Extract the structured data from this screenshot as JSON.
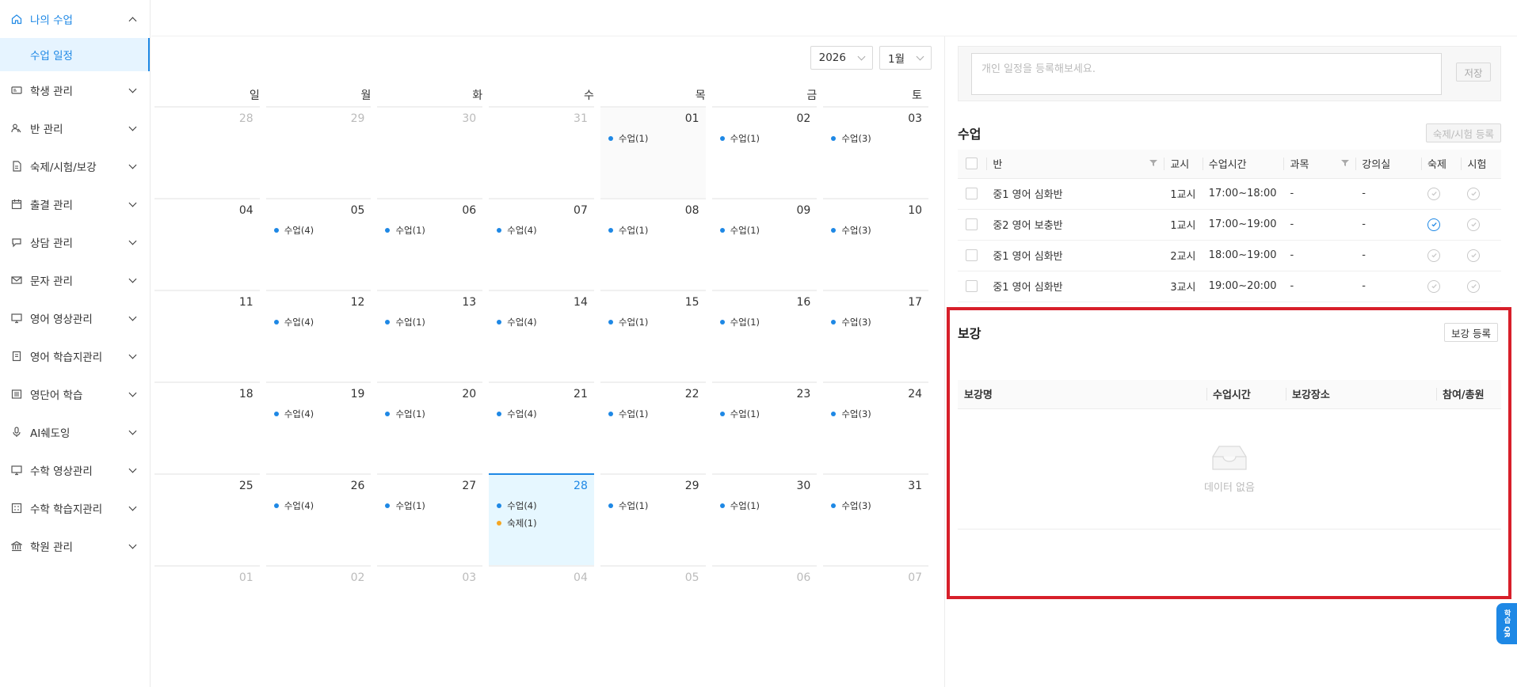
{
  "sidebar": {
    "items": [
      {
        "label": "나의 수업",
        "icon": "home-icon",
        "open": true,
        "sub": [
          {
            "label": "수업 일정"
          }
        ]
      },
      {
        "label": "학생 관리",
        "icon": "id-card-icon"
      },
      {
        "label": "반 관리",
        "icon": "users-icon"
      },
      {
        "label": "숙제/시험/보강",
        "icon": "file-icon"
      },
      {
        "label": "출결 관리",
        "icon": "calendar-icon"
      },
      {
        "label": "상담 관리",
        "icon": "chat-icon"
      },
      {
        "label": "문자 관리",
        "icon": "mail-icon"
      },
      {
        "label": "영어 영상관리",
        "icon": "monitor-icon"
      },
      {
        "label": "영어 학습지관리",
        "icon": "book-icon"
      },
      {
        "label": "영단어 학습",
        "icon": "word-icon"
      },
      {
        "label": "AI쉐도잉",
        "icon": "mic-icon"
      },
      {
        "label": "수학 영상관리",
        "icon": "monitor-icon"
      },
      {
        "label": "수학 학습지관리",
        "icon": "grid-icon"
      },
      {
        "label": "학원 관리",
        "icon": "bank-icon"
      }
    ]
  },
  "calendar": {
    "year": "2026",
    "month": "1월",
    "weekdays": [
      "일",
      "월",
      "화",
      "수",
      "목",
      "금",
      "토"
    ],
    "weeks": [
      [
        {
          "d": "28",
          "o": true
        },
        {
          "d": "29",
          "o": true
        },
        {
          "d": "30",
          "o": true
        },
        {
          "d": "31",
          "o": true
        },
        {
          "d": "01",
          "ev": [
            "수업(1)"
          ],
          "shade": true
        },
        {
          "d": "02",
          "ev": [
            "수업(1)"
          ]
        },
        {
          "d": "03",
          "ev": [
            "수업(3)"
          ]
        }
      ],
      [
        {
          "d": "04"
        },
        {
          "d": "05",
          "ev": [
            "수업(4)"
          ]
        },
        {
          "d": "06",
          "ev": [
            "수업(1)"
          ]
        },
        {
          "d": "07",
          "ev": [
            "수업(4)"
          ]
        },
        {
          "d": "08",
          "ev": [
            "수업(1)"
          ]
        },
        {
          "d": "09",
          "ev": [
            "수업(1)"
          ]
        },
        {
          "d": "10",
          "ev": [
            "수업(3)"
          ]
        }
      ],
      [
        {
          "d": "11"
        },
        {
          "d": "12",
          "ev": [
            "수업(4)"
          ]
        },
        {
          "d": "13",
          "ev": [
            "수업(1)"
          ]
        },
        {
          "d": "14",
          "ev": [
            "수업(4)"
          ]
        },
        {
          "d": "15",
          "ev": [
            "수업(1)"
          ]
        },
        {
          "d": "16",
          "ev": [
            "수업(1)"
          ]
        },
        {
          "d": "17",
          "ev": [
            "수업(3)"
          ]
        }
      ],
      [
        {
          "d": "18"
        },
        {
          "d": "19",
          "ev": [
            "수업(4)"
          ]
        },
        {
          "d": "20",
          "ev": [
            "수업(1)"
          ]
        },
        {
          "d": "21",
          "ev": [
            "수업(4)"
          ]
        },
        {
          "d": "22",
          "ev": [
            "수업(1)"
          ]
        },
        {
          "d": "23",
          "ev": [
            "수업(1)"
          ]
        },
        {
          "d": "24",
          "ev": [
            "수업(3)"
          ]
        }
      ],
      [
        {
          "d": "25"
        },
        {
          "d": "26",
          "ev": [
            "수업(4)"
          ]
        },
        {
          "d": "27",
          "ev": [
            "수업(1)"
          ]
        },
        {
          "d": "28",
          "ev": [
            "수업(4)",
            "숙제(1)"
          ],
          "today": true
        },
        {
          "d": "29",
          "ev": [
            "수업(1)"
          ]
        },
        {
          "d": "30",
          "ev": [
            "수업(1)"
          ]
        },
        {
          "d": "31",
          "ev": [
            "수업(3)"
          ]
        }
      ],
      [
        {
          "d": "01",
          "o": true
        },
        {
          "d": "02",
          "o": true
        },
        {
          "d": "03",
          "o": true
        },
        {
          "d": "04",
          "o": true
        },
        {
          "d": "05",
          "o": true
        },
        {
          "d": "06",
          "o": true
        },
        {
          "d": "07",
          "o": true
        }
      ]
    ],
    "colors": {
      "class_dot": "#1e88e5",
      "homework_dot": "#f5a623",
      "today_bg": "#e6f7ff"
    }
  },
  "memo": {
    "placeholder": "개인 일정을 등록해보세요.",
    "save_label": "저장"
  },
  "classes": {
    "title": "수업",
    "register_label": "숙제/시험 등록",
    "columns": [
      "반",
      "교시",
      "수업시간",
      "과목",
      "강의실",
      "숙제",
      "시험"
    ],
    "rows": [
      {
        "class": "중1 영어 심화반",
        "period": "1교시",
        "time": "17:00~18:00",
        "subject": "-",
        "room": "-",
        "hw": false,
        "test": false
      },
      {
        "class": "중2 영어 보충반",
        "period": "1교시",
        "time": "17:00~19:00",
        "subject": "-",
        "room": "-",
        "hw": true,
        "test": false
      },
      {
        "class": "중1 영어 심화반",
        "period": "2교시",
        "time": "18:00~19:00",
        "subject": "-",
        "room": "-",
        "hw": false,
        "test": false
      },
      {
        "class": "중1 영어 심화반",
        "period": "3교시",
        "time": "19:00~20:00",
        "subject": "-",
        "room": "-",
        "hw": false,
        "test": false
      }
    ]
  },
  "makeup": {
    "title": "보강",
    "register_label": "보강 등록",
    "columns": [
      "보강명",
      "수업시간",
      "보강장소",
      "참여/총원"
    ],
    "empty_text": "데이터 없음"
  },
  "float_button": {
    "label": "학습 QR"
  }
}
